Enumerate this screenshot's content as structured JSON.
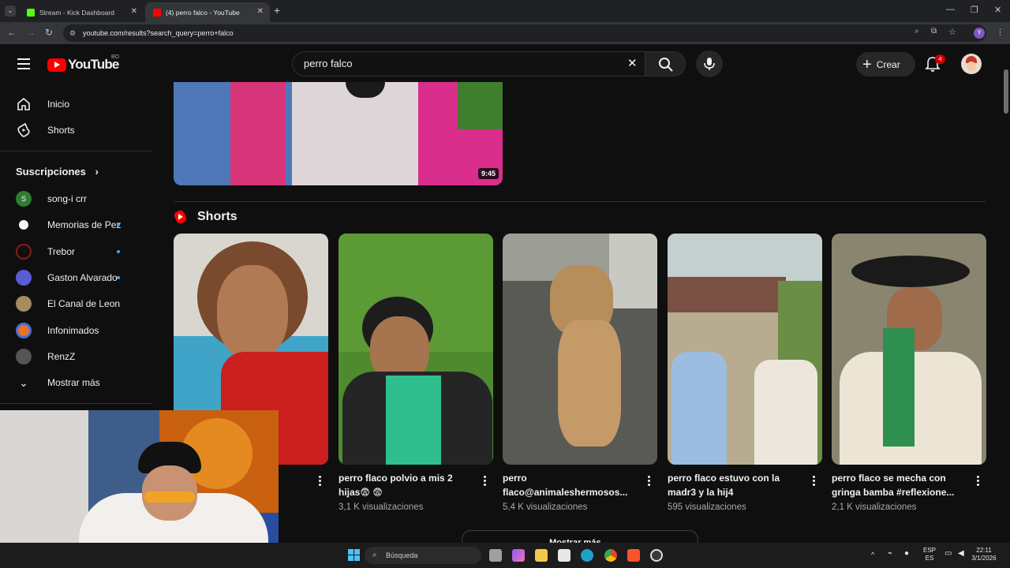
{
  "browser": {
    "tabs": [
      {
        "label": "Stream - Kick Dashboard",
        "active": false,
        "color": "#53fc18"
      },
      {
        "label": "(4) perro falco - YouTube",
        "active": true,
        "color": "#ff0000"
      }
    ],
    "url": "youtube.com/results?search_query=perro+falco",
    "profile_initial": "Y"
  },
  "header": {
    "logo_text": "YouTube",
    "country_code": "BO",
    "search_value": "perro falco",
    "create_label": "Crear",
    "notification_count": "4"
  },
  "sidebar": {
    "main": [
      {
        "label": "Inicio",
        "icon": "home-icon"
      },
      {
        "label": "Shorts",
        "icon": "shorts-icon"
      }
    ],
    "subscriptions_title": "Suscripciones",
    "subscriptions": [
      {
        "label": "song-i crr",
        "color": "#2e7d32",
        "new": false
      },
      {
        "label": "Memorias de Pez",
        "color": "#f5f5f5",
        "new": true
      },
      {
        "label": "Trebor",
        "color": "#8b1a1a",
        "new": true
      },
      {
        "label": "Gaston Alvarado",
        "color": "#5b5bd6",
        "new": true
      },
      {
        "label": "El Canal de Leon",
        "color": "#a58b5e",
        "new": false
      },
      {
        "label": "Infonimados",
        "color": "#e8722a",
        "new": false
      },
      {
        "label": "RenzZ",
        "color": "#555555",
        "new": false
      }
    ],
    "show_more": "Mostrar más"
  },
  "top_video": {
    "duration": "9:45"
  },
  "shorts": {
    "title": "Shorts",
    "items": [
      {
        "title": "",
        "views": ""
      },
      {
        "title": "perro flaco polvio a mis 2 hijas😨 😨",
        "views": "3,1 K visualizaciones"
      },
      {
        "title": "perro flaco@animaleshermosos...",
        "views": "5,4 K visualizaciones"
      },
      {
        "title": "perro flaco estuvo con la madr3 y la hij4",
        "views": "595 visualizaciones"
      },
      {
        "title": "perro flaco se mecha con gringa bamba #reflexione...",
        "views": "2,1 K visualizaciones"
      }
    ],
    "show_more": "Mostrar más"
  },
  "taskbar": {
    "search_placeholder": "Búsqueda",
    "lang_top": "ESP",
    "lang_bottom": "ES",
    "time": "22:11",
    "date": "3/1/2026"
  }
}
